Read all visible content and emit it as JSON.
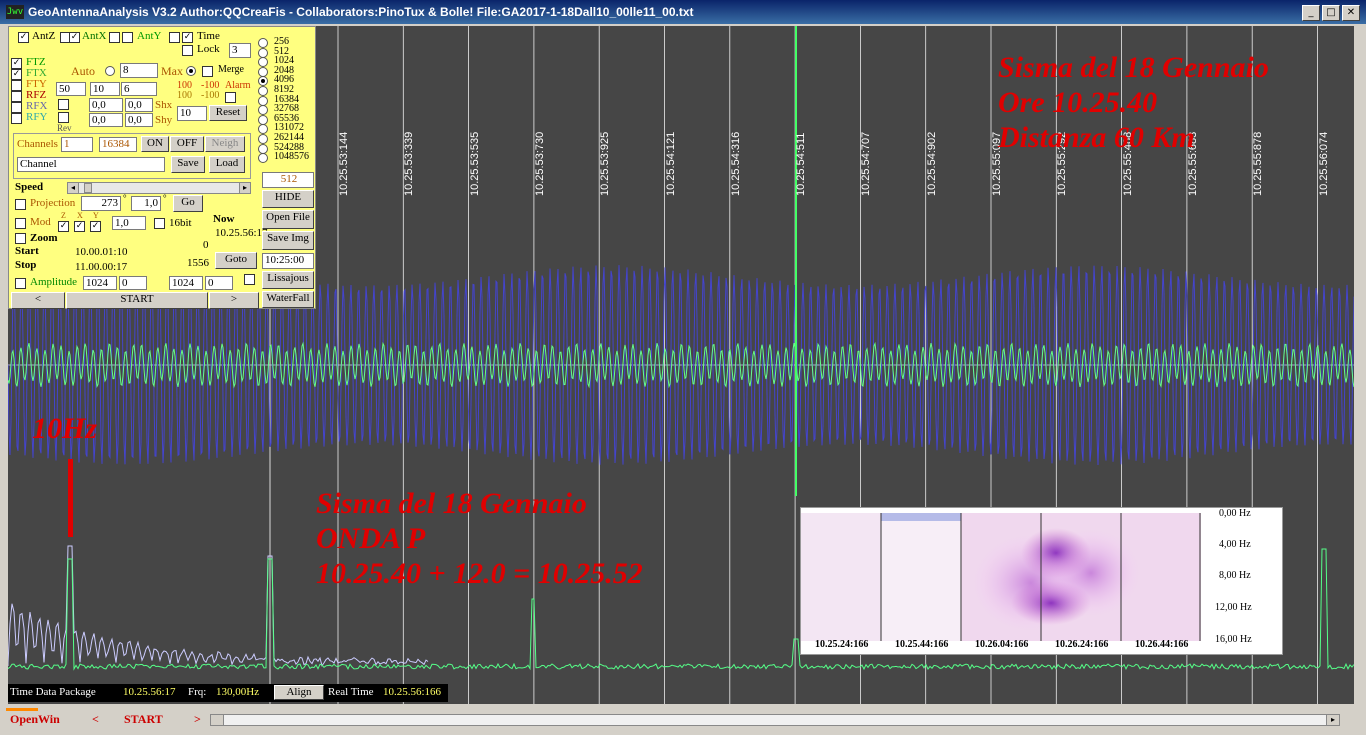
{
  "window": {
    "title": "GeoAntennaAnalysis V3.2 Author:QQCreaFis - Collaborators:PinoTux & Bolle!     File:GA2017-1-18Dall10_00lle11_00.txt",
    "icon_text": "Jwv",
    "buttons": [
      "minimize-icon",
      "maximize-icon",
      "close-icon"
    ],
    "btn_glyphs": [
      "_",
      "□",
      "✕"
    ]
  },
  "panel": {
    "antz": "AntZ",
    "antx": "AntX",
    "anty": "AntY",
    "time": "Time",
    "lock": "Lock",
    "lock_value": "3",
    "channels_list": [
      "FTZ",
      "FTX",
      "FTY",
      "RFZ",
      "RFX",
      "RFY"
    ],
    "auto": "Auto",
    "auto_value": "8",
    "max": "Max",
    "merge": "Merge",
    "row1": [
      "50",
      "10",
      "6"
    ],
    "alarm_labels": [
      "100",
      "-100",
      "Alarm"
    ],
    "alarm_labels2": [
      "100",
      "-100"
    ],
    "shx": "Shx",
    "shy": "Shy",
    "shx_vals": [
      "0,0",
      "0,0"
    ],
    "shy_vals": [
      "0,0",
      "0,0"
    ],
    "reset_val": "10",
    "reset": "Reset",
    "rev": "Rev",
    "channels": "Channels",
    "channels_from": "1",
    "channels_to": "16384",
    "on": "ON",
    "off": "OFF",
    "neigh": "Neigh",
    "channel_name": "Channel",
    "save": "Save",
    "load": "Load",
    "speed": "Speed",
    "projection": "Projection",
    "proj_angle": "273",
    "proj_val": "1,0",
    "go": "Go",
    "mod": "Mod",
    "mod_axes": [
      "Z",
      "X",
      "Y"
    ],
    "mod_val": "1,0",
    "bit16": "16bit",
    "now": "Now",
    "now_value": "10.25.56:17",
    "now_sub": "0",
    "zoom": "Zoom",
    "start": "Start",
    "start_value": "10.00.01:10",
    "stop": "Stop",
    "stop_value": "11.00.00:17",
    "goto_count": "1556",
    "goto": "Goto",
    "amplitude": "Amplitude",
    "amp_vals": [
      "1024",
      "0",
      "1024",
      "0"
    ],
    "prev": "<",
    "start_btn": "START",
    "next": ">"
  },
  "fft_sizes": [
    "256",
    "512",
    "1024",
    "2048",
    "4096",
    "8192",
    "16384",
    "32768",
    "65536",
    "131072",
    "262144",
    "524288",
    "1048576"
  ],
  "fft_selected": "4096",
  "side": {
    "fft_value": "512",
    "hide": "HIDE",
    "open_file": "Open File",
    "save_img": "Save Img",
    "time_value": "10:25:00",
    "lissajous": "Lissajous",
    "waterfall": "WaterFall"
  },
  "time_ticks": [
    "10.25.53:144",
    "10.25.53:339",
    "10.25.53:535",
    "10.25.53:730",
    "10.25.53:925",
    "10.25.54:121",
    "10.25.54:316",
    "10.25.54:511",
    "10.25.54:707",
    "10.25.54:902",
    "10.25.55:097",
    "10.25.55:292",
    "10.25.55:488",
    "10.25.55:683",
    "10.25.55:878",
    "10.25.56:074"
  ],
  "annotations": {
    "top": [
      "Sisma del 18 Gennaio",
      "Ore 10.25.40",
      "Distanza 60 Km"
    ],
    "hz": "10Hz",
    "mid": [
      "Sisma del 18 Gennaio",
      "ONDA P",
      "10.25.40 + 12.0 = 10.25.52"
    ]
  },
  "spectrogram": {
    "freq_labels": [
      "0,00 Hz",
      "4,00 Hz",
      "8,00 Hz",
      "12,00 Hz",
      "16,00 Hz"
    ],
    "time_labels": [
      "10.25.24:166",
      "10.25.44:166",
      "10.26.04:166",
      "10.26.24:166",
      "10.26.44:166"
    ]
  },
  "status": {
    "tdp_label": "Time Data Package",
    "tdp_value": "10.25.56:17",
    "frq_label": "Frq:",
    "frq_value": "130,00Hz",
    "align": "Align",
    "rt_label": "Real Time",
    "rt_value": "10.25.56:166"
  },
  "bottom": {
    "openwin": "OpenWin",
    "prev": "<",
    "start": "START",
    "next": ">"
  },
  "colors": {
    "blue_wave": "#4444cc",
    "green_wave": "#66ff88",
    "spectrum_lilac": "#ccccff",
    "annotation": "#e00000",
    "plot_bg": "#464646"
  }
}
